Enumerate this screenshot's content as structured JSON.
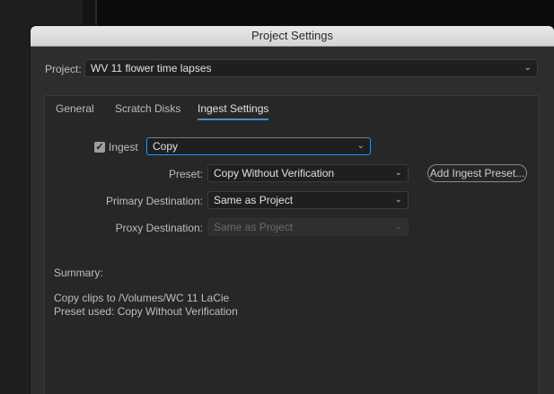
{
  "dialog": {
    "title": "Project Settings",
    "project_label": "Project:",
    "project_value": "WV 11 flower time lapses"
  },
  "tabs": [
    {
      "label": "General",
      "active": false
    },
    {
      "label": "Scratch Disks",
      "active": false
    },
    {
      "label": "Ingest Settings",
      "active": true
    }
  ],
  "ingest": {
    "checkbox_label": "Ingest",
    "checked": true,
    "mode_value": "Copy",
    "preset_label": "Preset:",
    "preset_value": "Copy Without Verification",
    "add_preset_button": "Add Ingest Preset...",
    "primary_label": "Primary Destination:",
    "primary_value": "Same as Project",
    "proxy_label": "Proxy Destination:",
    "proxy_value": "Same as Project"
  },
  "summary": {
    "heading": "Summary:",
    "line1": "Copy clips to /Volumes/WC 11 LaCie",
    "line2": "Preset used: Copy Without Verification"
  },
  "colors": {
    "accent": "#3b8edb",
    "dialog_bg": "#2d2d2d",
    "panel_bg": "#272727"
  }
}
